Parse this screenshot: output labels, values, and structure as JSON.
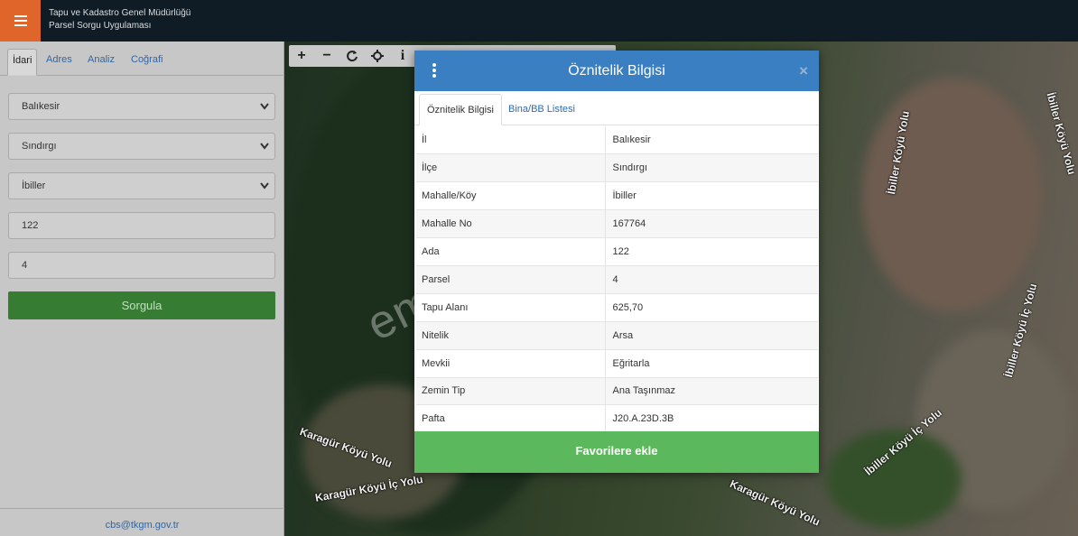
{
  "header": {
    "org_line1": "Tapu ve Kadastro Genel Müdürlüğü",
    "org_line2": "Parsel Sorgu Uygulaması"
  },
  "sidebar": {
    "tabs": [
      "İdari",
      "Adres",
      "Analiz",
      "Coğrafi"
    ],
    "active_tab": "İdari",
    "fields": {
      "il": "Balıkesir",
      "ilce": "Sındırgı",
      "mahalle": "İbiller",
      "ada": "122",
      "parsel": "4"
    },
    "submit_label": "Sorgula",
    "footer_email": "cbs@tkgm.gov.tr"
  },
  "map": {
    "toolbar": [
      "zoom-in-icon",
      "zoom-out-icon",
      "refresh-icon",
      "locate-icon",
      "info-icon"
    ],
    "zoom_in_glyph": "+",
    "zoom_out_glyph": "−",
    "info_glyph": "i",
    "roads": [
      "Karagür Köyü Yolu",
      "Karagür Köyü İç Yolu",
      "Karagür Köyü Yolu",
      "İbiller Köyü İç Yolu",
      "İbiller Köyü Yolu",
      "İbiller Köyü Yolu",
      "İbiller Köyü İç Yolu",
      "Karagür Köyü Yolu",
      "İbiller Köyü Yolu",
      "İbiller Köyü Yolu",
      "İbiller Köyü İç Yolu"
    ],
    "watermark": "emlakjet.com"
  },
  "modal": {
    "title": "Öznitelik Bilgisi",
    "close_glyph": "×",
    "tabs": [
      "Öznitelik Bilgisi",
      "Bina/BB Listesi"
    ],
    "rows": [
      {
        "key": "İl",
        "value": "Balıkesir"
      },
      {
        "key": "İlçe",
        "value": "Sındırgı"
      },
      {
        "key": "Mahalle/Köy",
        "value": "İbiller"
      },
      {
        "key": "Mahalle No",
        "value": "167764"
      },
      {
        "key": "Ada",
        "value": "122"
      },
      {
        "key": "Parsel",
        "value": "4"
      },
      {
        "key": "Tapu Alanı",
        "value": "625,70"
      },
      {
        "key": "Nitelik",
        "value": "Arsa"
      },
      {
        "key": "Mevkii",
        "value": "Eğritarla"
      },
      {
        "key": "Zemin Tip",
        "value": "Ana Taşınmaz"
      },
      {
        "key": "Pafta",
        "value": "J20.A.23D.3B"
      }
    ],
    "favorite_label": "Favorilere ekle"
  },
  "colors": {
    "header_bg": "#0f1c26",
    "menu_accent": "#e0652a",
    "modal_header": "#3a7fc1",
    "favorite_button": "#5cb85c",
    "submit_button": "#367d33"
  }
}
